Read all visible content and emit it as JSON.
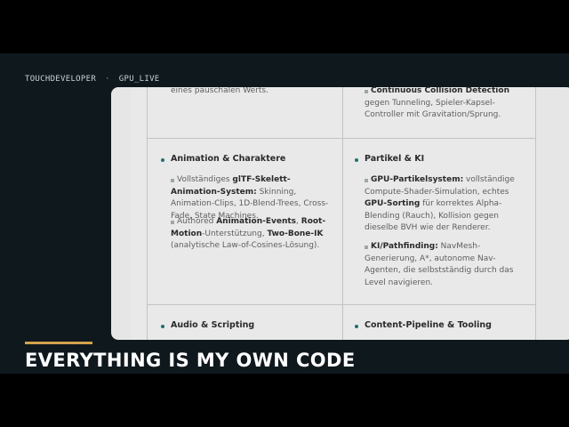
{
  "header": {
    "left": "TOUCHDEVELOPER",
    "sep": "·",
    "right": "GPU_LIVE"
  },
  "caption": "EVERYTHING IS MY OWN CODE",
  "cells": {
    "top_left": {
      "tail": "eines pauschalen Werts."
    },
    "top_right": {
      "b1": "Continuous Collision Detection",
      "t1": " gegen Tunneling, Spieler-Kapsel-Controller mit Gravitation/Sprung."
    },
    "anim": {
      "heading": "Animation & Charaktere",
      "i1_a": "Vollständiges ",
      "i1_b": "glTF-Skelett-Animation-System:",
      "i1_c": " Skinning, Animation-Clips, 1D-Blend-Trees, Cross-Fade, State Machines.",
      "i2_a": "Authored ",
      "i2_b": "Animation-Events",
      "i2_c": ", ",
      "i2_d": "Root-Motion",
      "i2_e": "-Unterstützung, ",
      "i2_f": "Two-Bone-IK",
      "i2_g": " (analytische Law-of-Cosines-Lösung)."
    },
    "partikel": {
      "heading": "Partikel & KI",
      "i1_a": "GPU-Partikelsystem:",
      "i1_b": " vollständige Compute-Shader-Simulation, echtes ",
      "i1_c": "GPU-Sorting",
      "i1_d": " für korrektes Alpha-Blending (Rauch), Kollision gegen dieselbe BVH wie der Renderer.",
      "i2_a": "KI/Pathfinding:",
      "i2_b": " NavMesh-Generierung, A*, autonome Nav-Agenten, die selbstständig durch das Level navigieren."
    },
    "audio": {
      "heading": "Audio & Scripting"
    },
    "content": {
      "heading": "Content-Pipeline & Tooling"
    }
  }
}
